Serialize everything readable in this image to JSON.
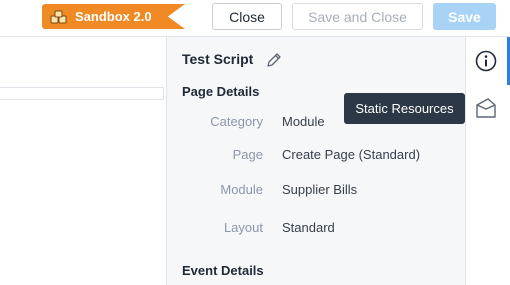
{
  "header": {
    "sandbox_label": "Sandbox 2.0",
    "close_label": "Close",
    "save_and_close_label": "Save and Close",
    "save_label": "Save"
  },
  "panel": {
    "title": "Test Script",
    "page_details_heading": "Page Details",
    "fields": [
      {
        "label": "Category",
        "value": "Module"
      },
      {
        "label": "Page",
        "value": "Create Page (Standard)"
      },
      {
        "label": "Module",
        "value": "Supplier Bills"
      },
      {
        "label": "Layout",
        "value": "Standard"
      }
    ],
    "event_details_heading": "Event Details"
  },
  "rail": {
    "items": [
      {
        "icon": "info-icon"
      },
      {
        "icon": "static-resources-icon"
      }
    ],
    "tooltip": "Static Resources"
  },
  "colors": {
    "sandbox_badge": "#f08a24",
    "save_button": "#a9d2f7",
    "active_rail": "#2a7fe0",
    "tooltip_bg": "#2c3845"
  }
}
